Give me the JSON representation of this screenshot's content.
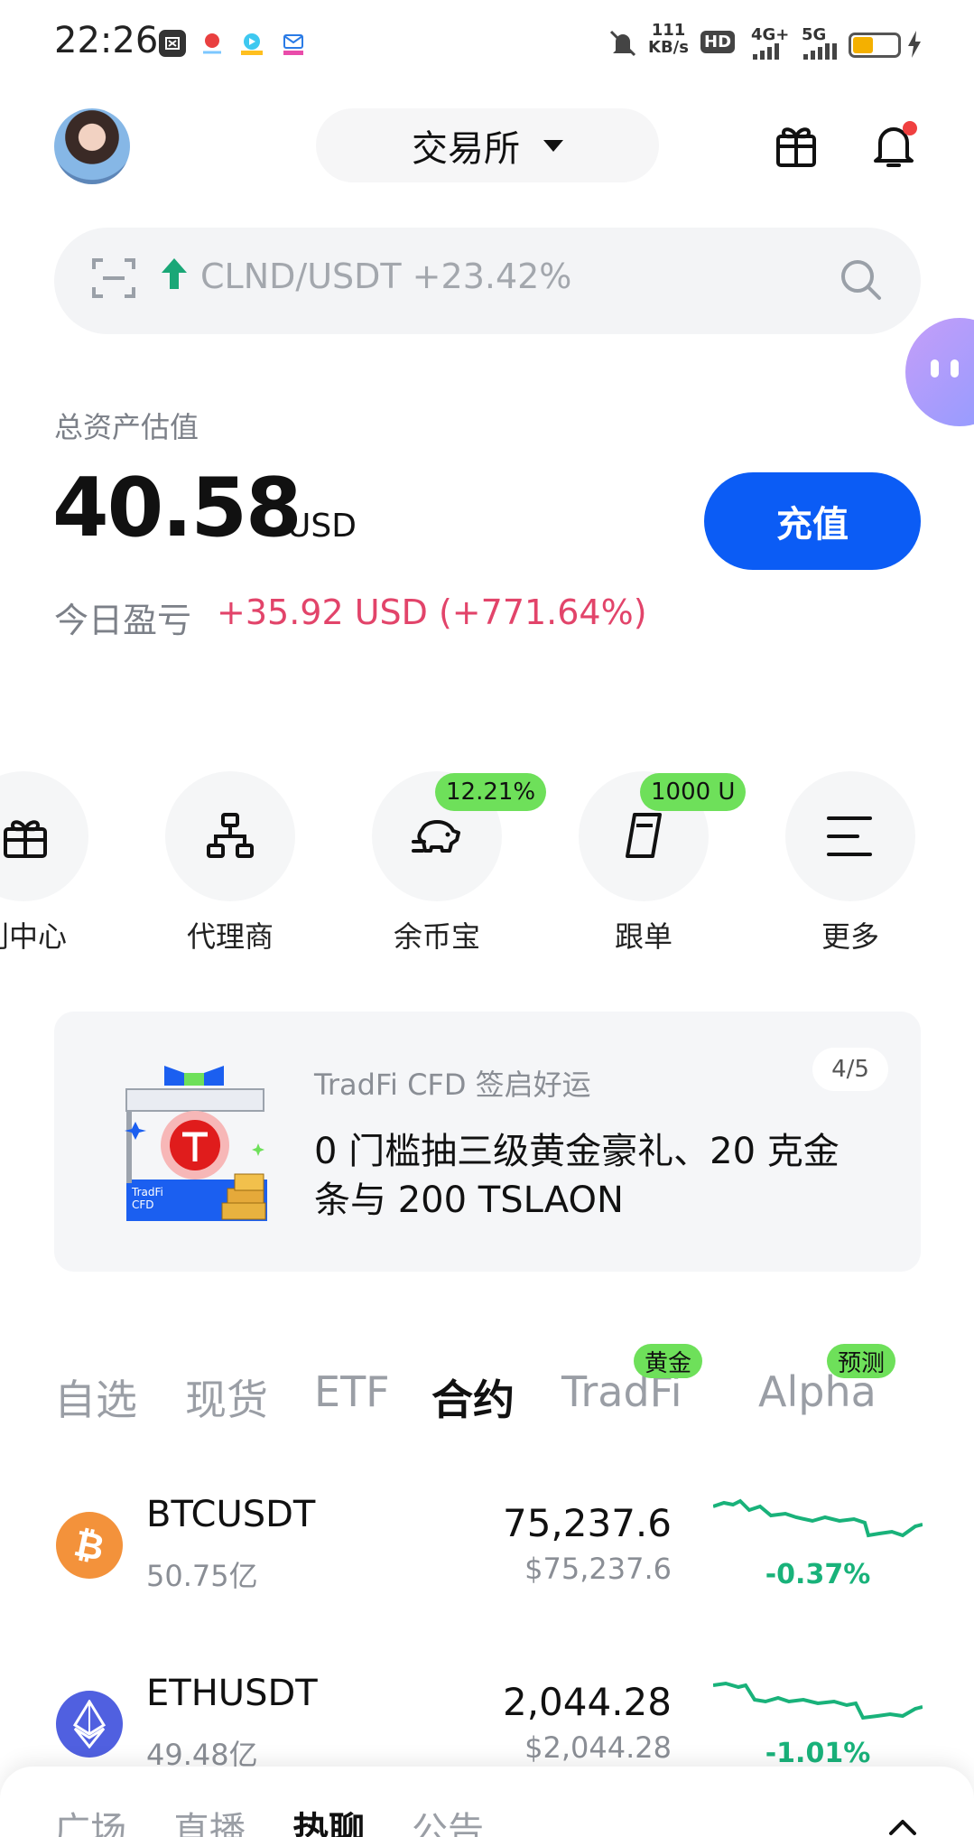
{
  "status_bar": {
    "time": "22:26",
    "speed": "111\nKB/s",
    "hd": "HD",
    "network_1": "4G+",
    "network_2": "5G"
  },
  "header": {
    "exchange_label": "交易所"
  },
  "search": {
    "text": "CLND/USDT +23.42%"
  },
  "assets": {
    "label": "总资产估值",
    "value": "40.58",
    "unit": "USD",
    "deposit_label": "充值",
    "pnl_label": "今日盈亏",
    "pnl_value": "+35.92 USD (+771.64%)"
  },
  "shortcuts": [
    {
      "label": "利中心",
      "badge": ""
    },
    {
      "label": "代理商",
      "badge": ""
    },
    {
      "label": "余币宝",
      "badge": "12.21%"
    },
    {
      "label": "跟单",
      "badge": "1000 U"
    },
    {
      "label": "更多",
      "badge": ""
    }
  ],
  "banner": {
    "subtitle": "TradFi CFD 签启好运",
    "title": "0 门槛抽三级黄金豪礼、20 克金条与 200 TSLAON",
    "page": "4/5",
    "art_label": "TradFi\nCFD"
  },
  "market_tabs": [
    {
      "label": "自选",
      "badge": ""
    },
    {
      "label": "现货",
      "badge": ""
    },
    {
      "label": "ETF",
      "badge": ""
    },
    {
      "label": "合约",
      "badge": ""
    },
    {
      "label": "TradFi",
      "badge": "黄金"
    },
    {
      "label": "Alpha",
      "badge": "预测"
    }
  ],
  "rows": [
    {
      "name": "BTCUSDT",
      "volume": "50.75亿",
      "price": "75,237.6",
      "usd": "$75,237.6",
      "change": "-0.37%",
      "icon": "bitcoin-icon",
      "color": "#f3923b"
    },
    {
      "name": "ETHUSDT",
      "volume": "49.48亿",
      "price": "2,044.28",
      "usd": "$2,044.28",
      "change": "-1.01%",
      "icon": "ethereum-icon",
      "color": "#5060e0"
    }
  ],
  "bottom_tabs": [
    {
      "label": "广场"
    },
    {
      "label": "直播"
    },
    {
      "label": "热聊"
    },
    {
      "label": "公告"
    }
  ],
  "colors": {
    "accent": "#0b5cf5",
    "positive": "#19b27a",
    "pnl": "#e2446a",
    "badge": "#6ee05a"
  }
}
